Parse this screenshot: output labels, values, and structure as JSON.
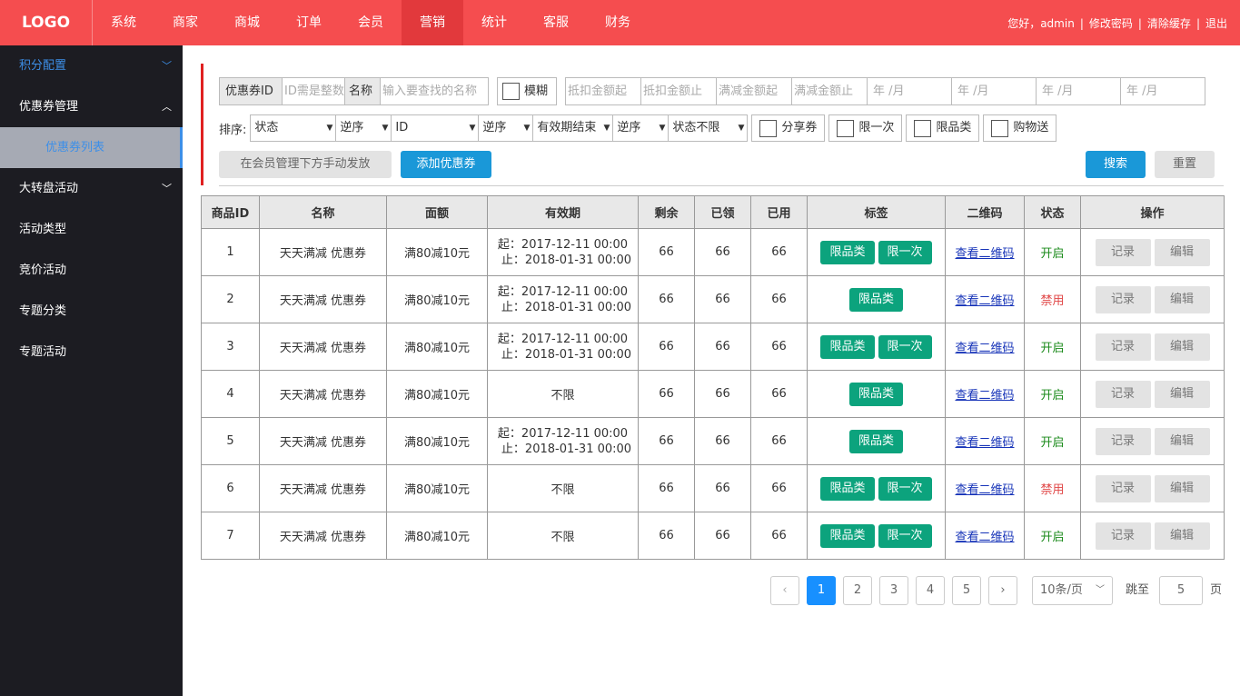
{
  "header": {
    "logo": "LOGO",
    "nav": [
      "系统",
      "商家",
      "商城",
      "订单",
      "会员",
      "营销",
      "统计",
      "客服",
      "财务"
    ],
    "greeting": "您好，admin",
    "change_pwd": "修改密码",
    "clear_cache": "清除缓存",
    "logout": "退出",
    "sep": "|"
  },
  "sidebar": {
    "items": [
      "积分配置",
      "优惠券管理",
      "大转盘活动",
      "活动类型",
      "竞价活动",
      "专题分类",
      "专题活动"
    ],
    "sub": "优惠券列表",
    "chev_down": "﹀",
    "chev_up": "︿"
  },
  "filters": {
    "coupon_id_label": "优惠券ID",
    "coupon_id_placeholder": "ID需是整数",
    "name_label": "名称",
    "name_placeholder": "输入要查找的名称",
    "fuzzy": "模糊",
    "deduct_from": "抵扣金额起",
    "deduct_to": "抵扣金额止",
    "reduce_from": "满减金额起",
    "reduce_to": "满减金额止",
    "date1": "年 /月",
    "date2": "年 /月",
    "date3": "年 /月",
    "date4": "年 /月"
  },
  "sort": {
    "label": "排序:",
    "s1": "状态",
    "s2": "逆序",
    "s3": "ID",
    "s4": "逆序",
    "s5": "有效期结束",
    "s6": "逆序",
    "s7": "状态不限",
    "share": "分享券",
    "once": "限一次",
    "limited": "限品类",
    "shop": "购物送"
  },
  "actions": {
    "manual": "在会员管理下方手动发放",
    "add": "添加优惠券",
    "search": "搜索",
    "reset": "重置"
  },
  "table": {
    "headers": [
      "商品ID",
      "名称",
      "面额",
      "有效期",
      "剩余",
      "已领",
      "已用",
      "标签",
      "二维码",
      "状态",
      "操作"
    ],
    "rows": [
      {
        "id": "1",
        "name": "天天满减 优惠券",
        "value": "满80减10元",
        "v1": "起：2017-12-11 00:00",
        "v2": "止：2018-01-31 00:00",
        "left": "66",
        "got": "66",
        "used": "66",
        "tag1": "限品类",
        "tag2": "限一次",
        "qr": "查看二维码",
        "status": "开启",
        "rec": "记录",
        "edit": "编辑"
      },
      {
        "id": "2",
        "name": "天天满减 优惠券",
        "value": "满80减10元",
        "v1": "起：2017-12-11 00:00",
        "v2": "止：2018-01-31 00:00",
        "left": "66",
        "got": "66",
        "used": "66",
        "tag1": "限品类",
        "tag2": "",
        "qr": "查看二维码",
        "status": "禁用",
        "rec": "记录",
        "edit": "编辑"
      },
      {
        "id": "3",
        "name": "天天满减 优惠券",
        "value": "满80减10元",
        "v1": "起：2017-12-11 00:00",
        "v2": "止：2018-01-31 00:00",
        "left": "66",
        "got": "66",
        "used": "66",
        "tag1": "限品类",
        "tag2": "限一次",
        "qr": "查看二维码",
        "status": "开启",
        "rec": "记录",
        "edit": "编辑"
      },
      {
        "id": "4",
        "name": "天天满减 优惠券",
        "value": "满80减10元",
        "v1": "不限",
        "v2": "",
        "left": "66",
        "got": "66",
        "used": "66",
        "tag1": "限品类",
        "tag2": "",
        "qr": "查看二维码",
        "status": "开启",
        "rec": "记录",
        "edit": "编辑"
      },
      {
        "id": "5",
        "name": "天天满减 优惠券",
        "value": "满80减10元",
        "v1": "起：2017-12-11 00:00",
        "v2": "止：2018-01-31 00:00",
        "left": "66",
        "got": "66",
        "used": "66",
        "tag1": "限品类",
        "tag2": "",
        "qr": "查看二维码",
        "status": "开启",
        "rec": "记录",
        "edit": "编辑"
      },
      {
        "id": "6",
        "name": "天天满减 优惠券",
        "value": "满80减10元",
        "v1": "不限",
        "v2": "",
        "left": "66",
        "got": "66",
        "used": "66",
        "tag1": "限品类",
        "tag2": "限一次",
        "qr": "查看二维码",
        "status": "禁用",
        "rec": "记录",
        "edit": "编辑"
      },
      {
        "id": "7",
        "name": "天天满减 优惠券",
        "value": "满80减10元",
        "v1": "不限",
        "v2": "",
        "left": "66",
        "got": "66",
        "used": "66",
        "tag1": "限品类",
        "tag2": "限一次",
        "qr": "查看二维码",
        "status": "开启",
        "rec": "记录",
        "edit": "编辑"
      }
    ]
  },
  "pagination": {
    "prev": "‹",
    "pages": [
      "1",
      "2",
      "3",
      "4",
      "5"
    ],
    "next": "›",
    "per_page": "10条/页",
    "jump_label": "跳至",
    "jump_value": "5",
    "page_suffix": "页"
  }
}
